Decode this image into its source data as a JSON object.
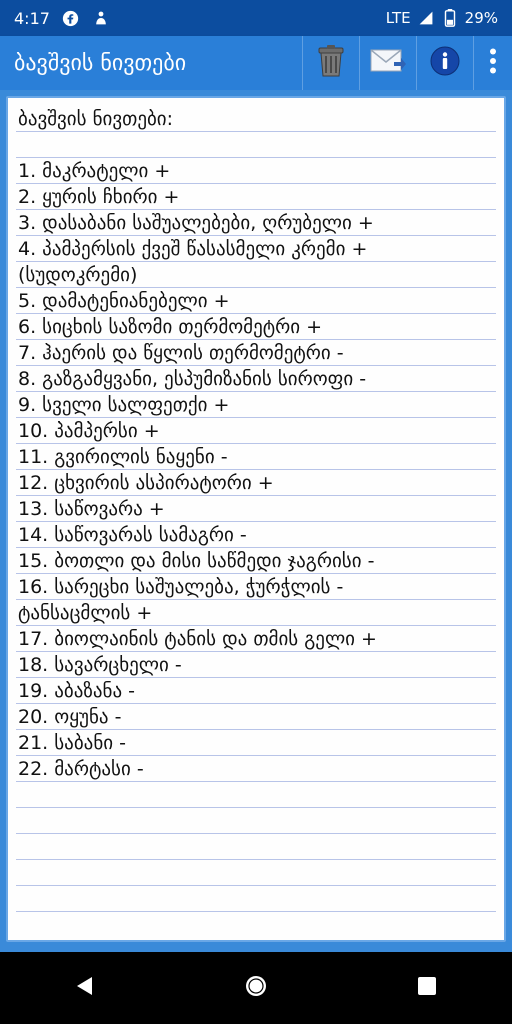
{
  "status_bar": {
    "time": "4:17",
    "network": "LTE",
    "battery": "29%"
  },
  "app_bar": {
    "title": "ბავშვის ნივთები",
    "actions": [
      "trash-icon",
      "mail-icon",
      "info-icon",
      "overflow-menu-icon"
    ]
  },
  "note": {
    "lines": [
      "ბავშვის ნივთები:",
      "",
      "1. მაკრატელი +",
      "2. ყურის ჩხირი +",
      "3. დასაბანი საშუალებები, ღრუბელი +",
      "4. პამპერსის ქვეშ წასასმელი კრემი +",
      "(სუდოკრემი)",
      "5. დამატენიანებელი +",
      "6. სიცხის საზომი თერმომეტრი +",
      "7. ჰაერის და წყლის თერმომეტრი -",
      "8. გაზგამყვანი, ესპუმიზანის სიროფი -",
      "9. სველი სალფეთქი +",
      "10. პამპერსი +",
      "11. გვირილის ნაყენი -",
      "12. ცხვირის ასპირატორი +",
      "13. საწოვარა +",
      "14. საწოვარას სამაგრი -",
      "15. ბოთლი და მისი საწმედი ჯაგრისი -",
      "16. სარეცხი საშუალება, ჭურჭლის -",
      "ტანსაცმლის +",
      "17. ბიოლაინის ტანის და თმის გელი +",
      "18. სავარცხელი -",
      "19. აბაზანა -",
      "20. ოყუნა -",
      "21. საბანი -",
      "22. მარტასი -"
    ]
  },
  "colors": {
    "status_bar": "#0c4d9f",
    "app_bar": "#2a7fd8",
    "content_bg": "#3a8ad9",
    "note_line": "#b8c4e8"
  }
}
